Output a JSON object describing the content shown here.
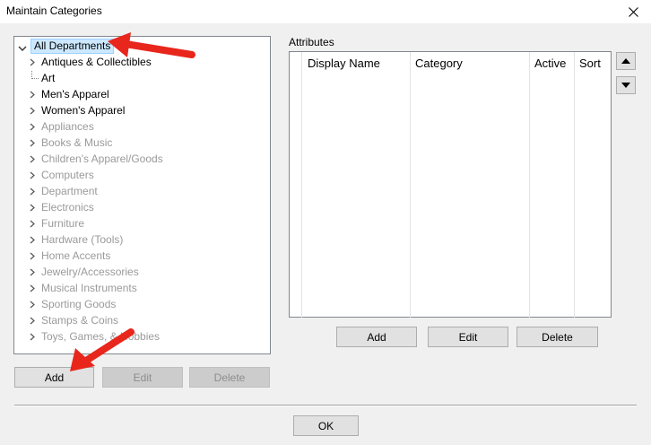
{
  "window": {
    "title": "Maintain Categories"
  },
  "tree": {
    "root": "All Departments",
    "active_items": [
      "Antiques & Collectibles",
      "Art",
      "Men's Apparel",
      "Women's Apparel"
    ],
    "disabled_items": [
      "Appliances",
      "Books & Music",
      "Children's Apparel/Goods",
      "Computers",
      "Department",
      "Electronics",
      "Furniture",
      "Hardware (Tools)",
      "Home Accents",
      "Jewelry/Accessories",
      "Musical Instruments",
      "Sporting Goods",
      "Stamps & Coins",
      "Toys, Games, & Hobbies"
    ]
  },
  "left_buttons": {
    "add": "Add",
    "edit": "Edit",
    "delete": "Delete"
  },
  "attributes": {
    "label": "Attributes",
    "columns": [
      "Display Name",
      "Category",
      "Active",
      "Sort"
    ]
  },
  "attr_buttons": {
    "add": "Add",
    "edit": "Edit",
    "delete": "Delete"
  },
  "ok_label": "OK",
  "colors": {
    "selection": "#cce8ff",
    "annotation_arrow": "#e8261c"
  }
}
